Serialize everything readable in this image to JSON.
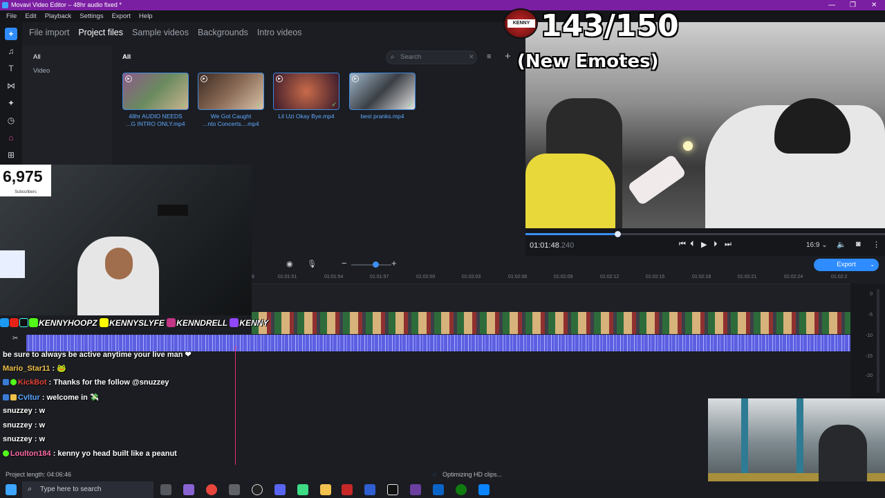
{
  "window": {
    "title": "Movavi Video Editor – 48hr audio fixed *"
  },
  "menu": [
    "File",
    "Edit",
    "Playback",
    "Settings",
    "Export",
    "Help"
  ],
  "tabs": [
    {
      "label": "File import"
    },
    {
      "label": "Project files",
      "selected": true
    },
    {
      "label": "Sample videos"
    },
    {
      "label": "Backgrounds"
    },
    {
      "label": "Intro videos"
    }
  ],
  "categories": [
    "All",
    "Video"
  ],
  "files_panel": {
    "header": "All",
    "search_placeholder": "Search"
  },
  "files": [
    {
      "name_line1": "48hr AUDIO NEEDS",
      "name_line2": "...G INTRO ONLY.mp4"
    },
    {
      "name_line1": "We Got Caught",
      "name_line2": "...nto Concerts....mp4"
    },
    {
      "name_line1": "Lil Uzi Okay Bye.mp4",
      "name_line2": ""
    },
    {
      "name_line1": "best pranks.mp4",
      "name_line2": ""
    }
  ],
  "stream_overlay": {
    "goal": "143/150",
    "goal_caption": "(New Emotes)",
    "logo_text": "KENNY",
    "subscriber_count": "6,975",
    "subscriber_label": "Subscribers",
    "socials": [
      "KENNYHOOPZ",
      "KENNYSLYFE",
      "KENNDRELL",
      "KENNY"
    ]
  },
  "player": {
    "timecode": "01:01:48",
    "timecode_ms": ".240",
    "progress_fraction": 0.255,
    "aspect": "16:9 ⌄"
  },
  "timeline": {
    "export_label": "Export",
    "ruler": [
      "8",
      "01:01:51",
      "01:01:54",
      "01:01:57",
      "01:02:00",
      "01:02:03",
      "01:02:06",
      "01:02:09",
      "01:02:12",
      "01:02:15",
      "01:02:18",
      "01:02:21",
      "01:02:24",
      "01:02:2"
    ],
    "meter": [
      "0",
      "-5",
      "-10",
      "-15",
      "-20"
    ]
  },
  "chat": [
    {
      "user": "",
      "text": "be sure to always be active anytime your live man ❤",
      "user_color": "#ffffff"
    },
    {
      "user": "Mario_Star11",
      "text": ": 🐸",
      "user_color": "#f0c24a"
    },
    {
      "user": "KickBot",
      "text": ": Thanks for the follow @snuzzey",
      "user_color": "#e0443a"
    },
    {
      "user": "Cvltur",
      "text": ": welcome in 💸",
      "user_color": "#5aa6ff"
    },
    {
      "user": "snuzzey",
      "text": ": w",
      "user_color": "#ffffff"
    },
    {
      "user": "snuzzey",
      "text": ": w",
      "user_color": "#ffffff"
    },
    {
      "user": "snuzzey",
      "text": ": w",
      "user_color": "#ffffff"
    },
    {
      "user": "Loulton184",
      "text": ": kenny yo head built like a peanut",
      "user_color": "#ff6aa8"
    }
  ],
  "status": {
    "project_length": "Project length: 04:06:46",
    "optimizing": "Optimizing HD clips..."
  },
  "taskbar": {
    "search_placeholder": "Type here to search"
  }
}
